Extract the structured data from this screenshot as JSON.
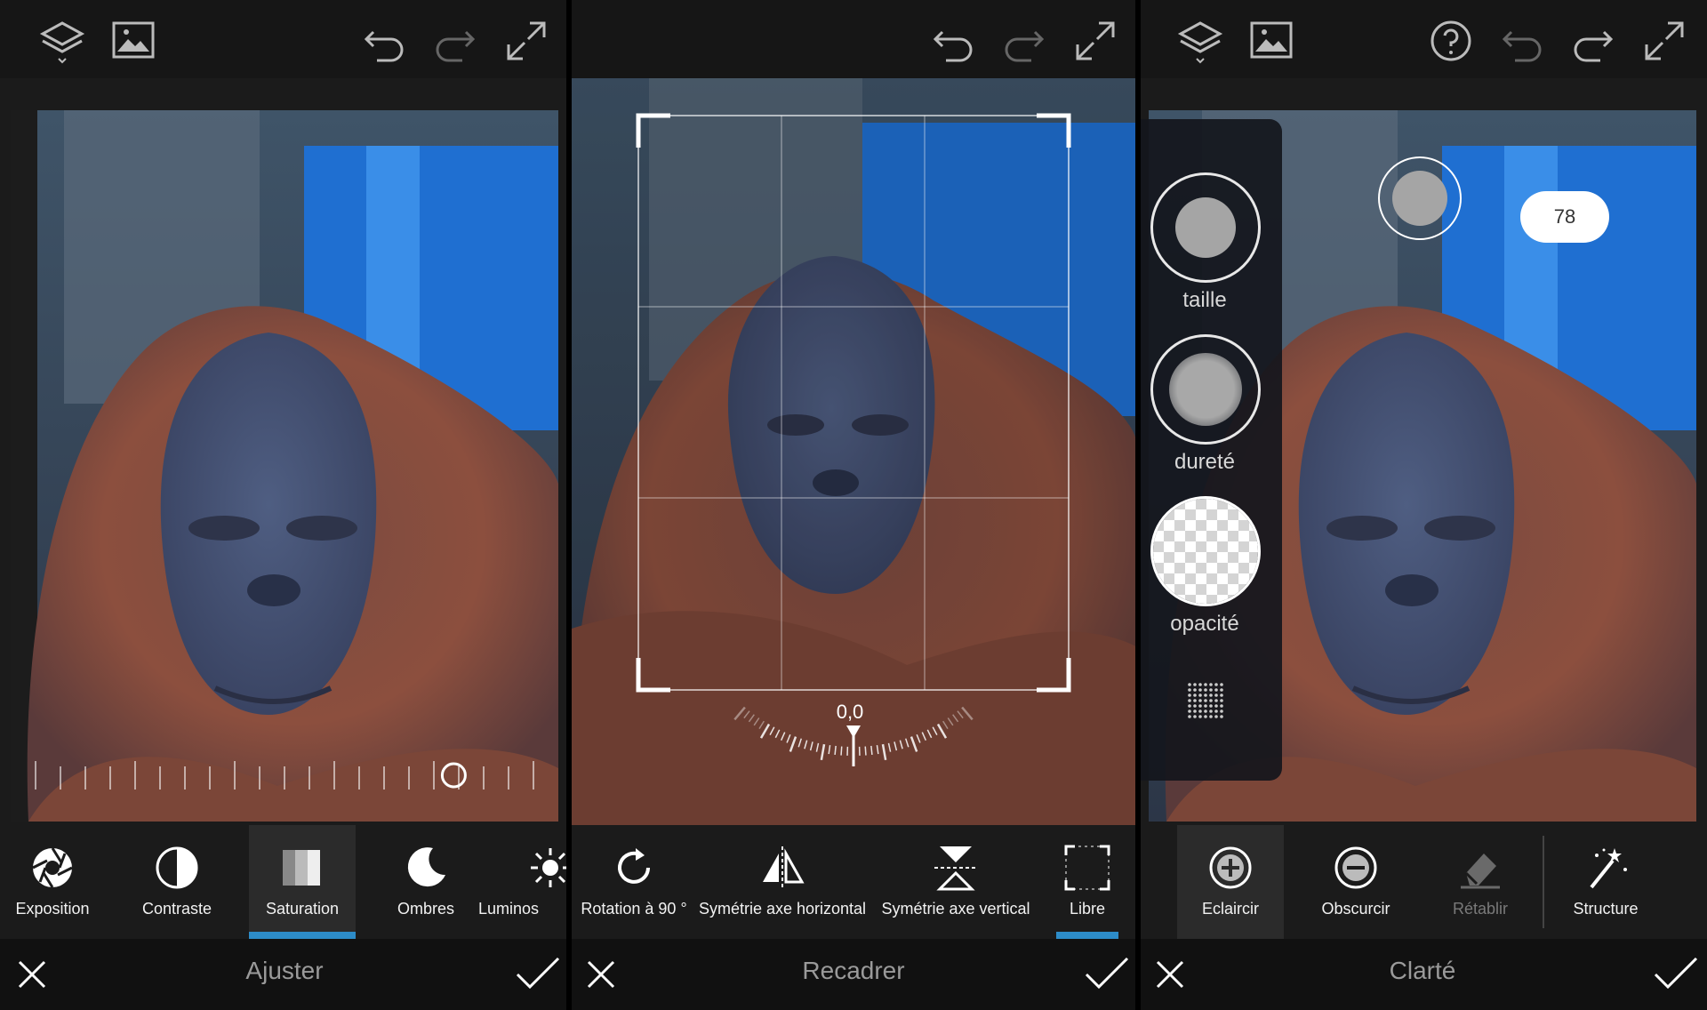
{
  "panels": [
    {
      "tools": [
        {
          "label": "Exposition",
          "icon": "aperture-icon"
        },
        {
          "label": "Contraste",
          "icon": "contrast-icon"
        },
        {
          "label": "Saturation",
          "icon": "saturation-icon",
          "selected": true
        },
        {
          "label": "Ombres",
          "icon": "moon-icon"
        },
        {
          "label": "Luminos",
          "icon": "sun-icon"
        }
      ],
      "mode_title": "Ajuster",
      "slider_level": 0.84
    },
    {
      "tools": [
        {
          "label": "Rotation à 90 °",
          "icon": "rotate-icon"
        },
        {
          "label": "Symétrie axe horizontal",
          "icon": "flip-horizontal-icon"
        },
        {
          "label": "Symétrie axe vertical",
          "icon": "flip-vertical-icon"
        },
        {
          "label": "Libre",
          "icon": "free-crop-icon",
          "selected": true
        }
      ],
      "mode_title": "Recadrer",
      "angle": "0,0"
    },
    {
      "tools": [
        {
          "label": "Eclaircir",
          "icon": "plus-circle-icon",
          "selected": true
        },
        {
          "label": "Obscurcir",
          "icon": "minus-circle-icon"
        },
        {
          "label": "Rétablir",
          "icon": "eraser-icon",
          "disabled": true
        },
        {
          "label": "Structure",
          "icon": "magic-wand-icon"
        }
      ],
      "mode_title": "Clarté",
      "brush": {
        "size_label": "taille",
        "hardness_label": "dureté",
        "opacity_label": "opacité",
        "value": "78"
      }
    }
  ],
  "colors": {
    "accent": "#2d8cc8",
    "bar": "#161616",
    "toolbar": "#1b1b1b"
  }
}
